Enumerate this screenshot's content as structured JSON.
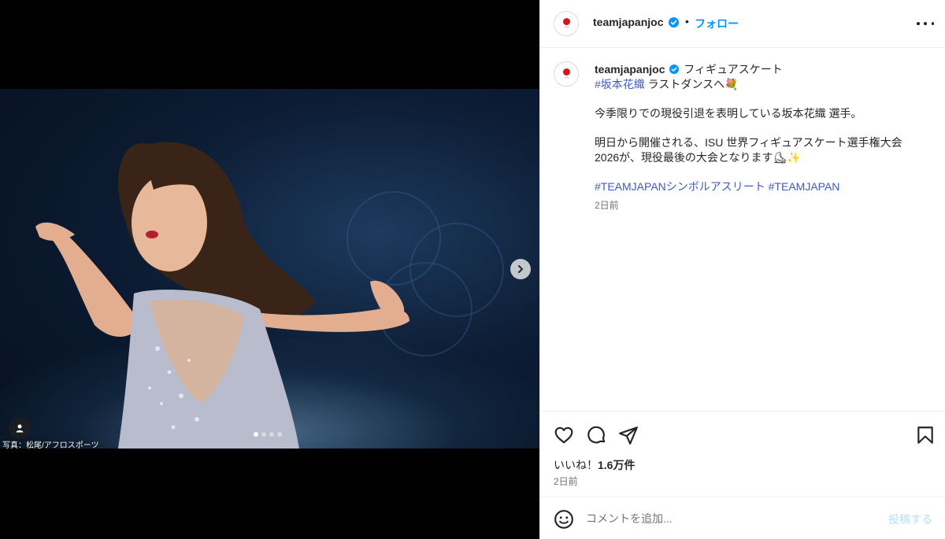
{
  "media": {
    "photo_credit": "写真：松尾/アフロスポーツ",
    "carousel_count": 4,
    "carousel_active_index": 0
  },
  "header": {
    "username": "teamjapanjoc",
    "separator": "•",
    "follow_label": "フォロー"
  },
  "caption": {
    "username": "teamjapanjoc",
    "line1_text": "フィギュアスケート",
    "hashtag_name": "#坂本花織",
    "line2_text": " ラストダンスへ💐",
    "para1": "今季限りでの現役引退を表明している坂本花織 選手。",
    "para2": "明日から開催される、ISU 世界フィギュアスケート選手権大会 2026が、現役最後の大会となります⛸✨",
    "hashtags": "#TEAMJAPANシンボルアスリート #TEAMJAPAN",
    "time": "2日前"
  },
  "actions": {
    "likes_prefix": "いいね！",
    "likes_count": "1.6万件",
    "post_time": "2日前"
  },
  "comment": {
    "placeholder": "コメントを追加...",
    "post_label": "投稿する"
  },
  "colors": {
    "link_blue": "#0095f6",
    "hashtag_blue": "#3f5ac8",
    "verified_blue": "#0095f6",
    "post_disabled": "#b2dffc",
    "jp_red": "#d7141d"
  },
  "icons": {
    "like": "heart-icon",
    "comment": "comment-icon",
    "share": "send-icon",
    "save": "bookmark-icon",
    "emoji": "emoji-icon",
    "more": "more-icon",
    "next": "chevron-right-icon",
    "tag": "user-tag-icon",
    "verified": "verified-badge-icon"
  }
}
